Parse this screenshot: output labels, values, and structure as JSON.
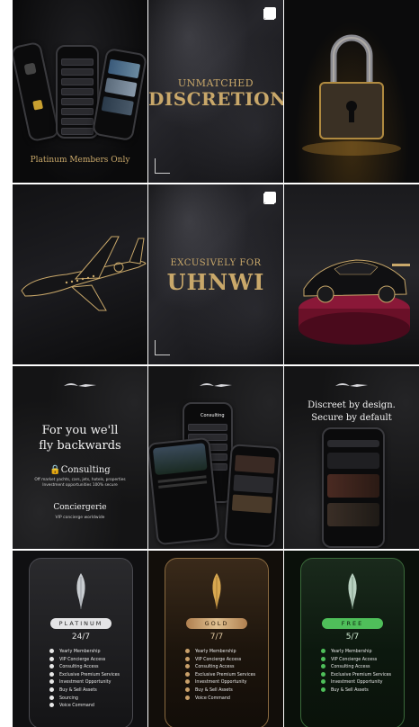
{
  "tiles": {
    "t1": {
      "caption": "Platinum Members Only"
    },
    "t2": {
      "line1": "UNMATCHED",
      "line2": "DISCRETION"
    },
    "t5": {
      "line1": "EXCUSIVELY FOR",
      "line2": "UHNWI"
    },
    "t7": {
      "headline_1": "For you we'll",
      "headline_2": "fly backwards",
      "consulting_title": "Consulting",
      "consulting_sub_1": "Off market yachts, cars, jets, hotels, properties",
      "consulting_sub_2": "Investment opportunities 100% secure",
      "concierge_title": "Conciergerie",
      "concierge_sub": "VIP concierge worldwide"
    },
    "t8": {
      "app_title": "Consulting"
    },
    "t9": {
      "headline_1": "Discreet by design.",
      "headline_2": "Secure by default"
    }
  },
  "plans": {
    "platinum": {
      "name": "PLATINUM",
      "availability": "24/7",
      "features": [
        "Yearly Membership",
        "VIP Concierge Access",
        "Consulting Access",
        "Exclusive Premium Services",
        "Investment Opportunity",
        "Buy & Sell Assets",
        "Sourcing",
        "Voice Command"
      ]
    },
    "gold": {
      "name": "GOLD",
      "availability": "7/7",
      "features": [
        "Yearly Membership",
        "VIP Concierge Access",
        "Consulting Access",
        "Exclusive Premium Services",
        "Investment Opportunity",
        "Buy & Sell Assets",
        "Voice Command"
      ]
    },
    "free": {
      "name": "FREE",
      "availability": "5/7",
      "features": [
        "Yearly Membership",
        "VIP Concierge Access",
        "Consulting Access",
        "Exclusive Premium Services",
        "Investment Opportunity",
        "Buy & Sell Assets"
      ]
    }
  },
  "colors": {
    "gold": "#c9a86a",
    "platinum": "#d9d9dc",
    "free_green": "#4fbf5a",
    "background": "#0d0d0f"
  },
  "icons": [
    "multiple-posts-icon",
    "lock-icon",
    "hummingbird-logo-icon",
    "quill-icon"
  ]
}
